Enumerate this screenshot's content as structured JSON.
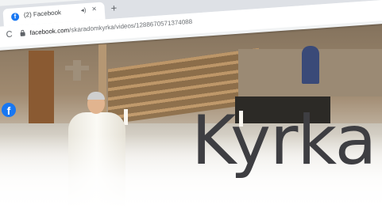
{
  "browser": {
    "tab_title": "(2) Facebook",
    "tab_audio_icon": "speaker-icon",
    "tab_close_icon": "close-icon",
    "new_tab_label": "+",
    "reload_icon": "reload-icon",
    "url_host": "facebook.com",
    "url_path": "/skaradomkyrka/videos/1288670571374088"
  },
  "overlay": {
    "facebook_logo_letter": "f",
    "headline": "Kyrka"
  },
  "colors": {
    "facebook_blue": "#1877f2",
    "headline": "#3e3e42"
  }
}
